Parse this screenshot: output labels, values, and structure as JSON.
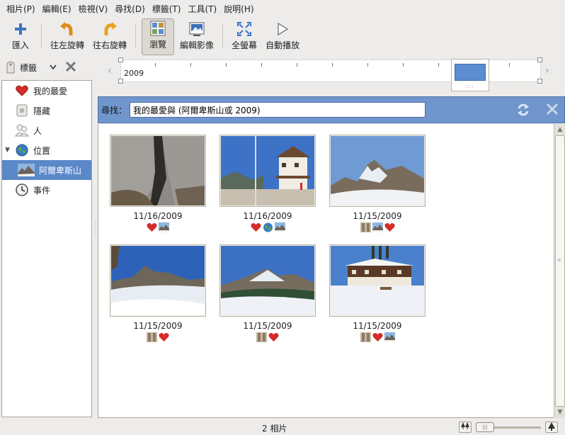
{
  "menubar": {
    "items": [
      "相片(P)",
      "編輯(E)",
      "檢視(V)",
      "尋找(D)",
      "標籤(T)",
      "工具(T)",
      "說明(H)"
    ]
  },
  "toolbar": {
    "import": "匯入",
    "rotate_left": "往左旋轉",
    "rotate_right": "往右旋轉",
    "browse": "瀏覽",
    "edit_image": "編輯影像",
    "fullscreen": "全螢幕",
    "slideshow": "自動播放"
  },
  "tagbar": {
    "label": "標籤"
  },
  "sidebar": {
    "items": [
      {
        "label": "我的最愛",
        "icon": "heart-icon"
      },
      {
        "label": "隱藏",
        "icon": "lock-icon"
      },
      {
        "label": "人",
        "icon": "people-icon"
      },
      {
        "label": "位置",
        "icon": "globe-icon"
      },
      {
        "label": "阿爾卑斯山",
        "icon": "mountain-thumbnail-icon",
        "selected": true
      },
      {
        "label": "事件",
        "icon": "clock-icon"
      }
    ]
  },
  "timeline": {
    "year": "2009"
  },
  "search": {
    "label": "尋找：",
    "value": "我的最愛與 (阿爾卑斯山或 2009)"
  },
  "photos": [
    {
      "date": "11/16/2009",
      "tags": [
        "heart-icon",
        "mountain-thumbnail-icon"
      ]
    },
    {
      "date": "11/16/2009",
      "tags": [
        "heart-icon",
        "globe-icon",
        "mountain-thumbnail-icon"
      ]
    },
    {
      "date": "11/15/2009",
      "tags": [
        "mountain-thumbnail-icon",
        "mountain-thumbnail-icon",
        "heart-icon"
      ]
    },
    {
      "date": "11/15/2009",
      "tags": [
        "mountain-thumbnail-icon",
        "heart-icon"
      ]
    },
    {
      "date": "11/15/2009",
      "tags": [
        "mountain-thumbnail-icon",
        "heart-icon"
      ]
    },
    {
      "date": "11/15/2009",
      "tags": [
        "mountain-thumbnail-icon",
        "heart-icon",
        "mountain-thumbnail-icon"
      ]
    }
  ],
  "status": {
    "text": "2 相片"
  },
  "colors": {
    "accent": "#5a88c9",
    "search_bar": "#6f95cc",
    "heart": "#d42b2b"
  }
}
